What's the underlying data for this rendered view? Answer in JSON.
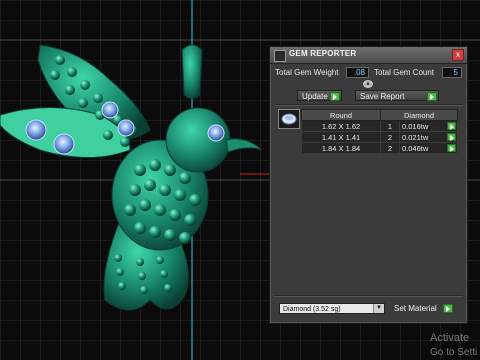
{
  "panel": {
    "title": "GEM REPORTER",
    "close_label": "x",
    "total_weight_label": "Total Gem Weight",
    "total_weight_value": ".08",
    "total_count_label": "Total Gem Count",
    "total_count_value": "5",
    "update_label": "Update",
    "save_report_label": "Save Report",
    "table": {
      "headers": [
        "Round",
        "Diamond"
      ],
      "rows": [
        {
          "size": "1.62 X 1.62",
          "count": "1",
          "weight": "0.016tw"
        },
        {
          "size": "1.41 X 1.41",
          "count": "2",
          "weight": "0.021tw"
        },
        {
          "size": "1.84 X 1.84",
          "count": "2",
          "weight": "0.046tw"
        }
      ]
    },
    "material_select": "Diamond    (3.52 sg)",
    "set_material_label": "Set Material"
  },
  "watermark": {
    "line1": "Activate",
    "line2": "Go to Setti"
  },
  "icons": {
    "collapse": "chevron-up-icon",
    "gem": "round-gem-icon"
  },
  "colors": {
    "model": "#1f9a74",
    "grid": "#3a3a3a",
    "value_text": "#7fd0ff",
    "arrow_green": "#49b849"
  }
}
